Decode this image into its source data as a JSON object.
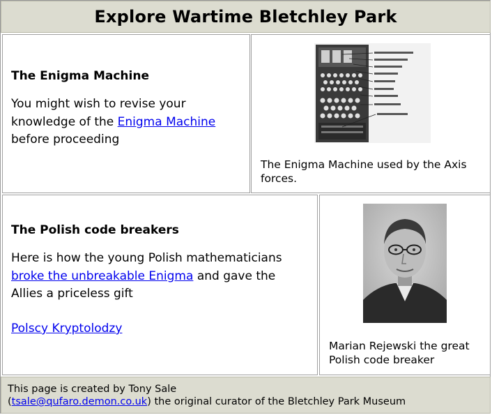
{
  "header": {
    "title": "Explore Wartime Bletchley Park"
  },
  "enigma": {
    "heading": "The Enigma Machine",
    "text_before": "You might wish to revise your knowledge of the",
    "link": "Enigma Machine",
    "text_after": "before proceeding",
    "caption": "The Enigma Machine used by the Axis forces."
  },
  "polish": {
    "heading": "The Polish code breakers",
    "text_before": "Here is how the young Polish mathematicians",
    "link": "broke the unbreakable Enigma",
    "text_after": "and gave the Allies a priceless gift",
    "link2": "Polscy Kryptolodzy",
    "caption": "Marian Rejewski the great Polish code breaker"
  },
  "footer": {
    "line1": "This page is created by Tony Sale",
    "email": "tsale@qufaro.demon.co.uk",
    "line2_after": "the original curator of the Bletchley Park Museum"
  }
}
